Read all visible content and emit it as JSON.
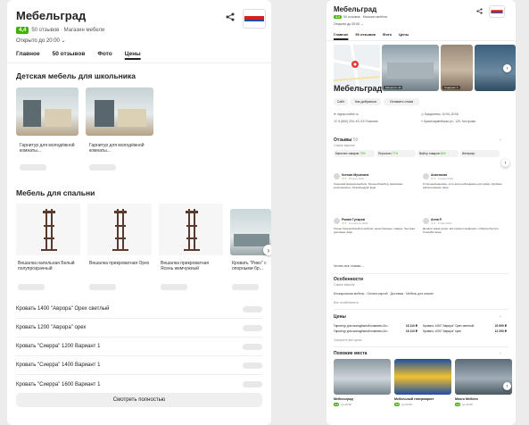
{
  "left": {
    "title": "Мебельград",
    "rating": "4,4",
    "meta": "50 отзывов · Магазин мебели",
    "hours": "Открыто до 20:00",
    "tabs": [
      "Главное",
      "50 отзывов",
      "Фото",
      "Цены"
    ],
    "section_kids": "Детская мебель для школьника",
    "kids_items": [
      "Гарнитур для молодёжной комнаты...",
      "Гарнитур для молодёжной комнаты..."
    ],
    "section_bedroom": "Мебель для спальни",
    "bedroom_items": [
      "Вешалка напольная Белый полупрозрачный",
      "Вешалка прикроватная Орех",
      "Вешалка прикроватная Ясень жемчужный",
      "Кровать \"Рико\" с опорными бр..."
    ],
    "rows": [
      "Кровать 1400 \"Аврора\" Орех светлый",
      "Кровать 1200 \"Аврора\" орех",
      "Кровать \"Сиерра\" 1200 Вариант 1",
      "Кровать \"Сиерра\" 1400 Вариант 1",
      "Кровать \"Сиерра\" 1600 Вариант 1"
    ],
    "view_all": "Смотреть полностью"
  },
  "right": {
    "top_title": "Мебельград",
    "top_rating": "4,4",
    "top_meta": "50 отзывов · Магазин мебели",
    "top_hours": "Открыто до 20:00",
    "tabs": [
      "Главное",
      "50 отзывов",
      "Фото",
      "Цены"
    ],
    "title": "Мебельград",
    "photo_labels": [
      "Как фото: 11",
      "Снаружи: 1"
    ],
    "buttons": [
      "Сайт",
      "Как добраться",
      "Оставить отзыв"
    ],
    "info_left_1": "mgrad-mebel.ru",
    "info_left_2": "8 (800) 2XX-XX-XX Показать",
    "info_right_1": "Ежедневно, 10:00–20:00",
    "info_right_2": "Красноармейская ул., 125, Кострома",
    "reviews_title": "Отзывы",
    "reviews_count": "50",
    "reviews_sub": "Самое важное",
    "review_tags": [
      "Качество товаров",
      "Персонал",
      "Выбор товаров",
      "Интерьер"
    ],
    "tag_pcts": [
      "73%",
      "77%",
      "66%",
      "..."
    ],
    "reviewers": [
      "Ксения Мусихина",
      "Анастасия",
      "Роман Гусаров",
      "Анна Р."
    ],
    "review_dates": [
      "15 мая 2024",
      "3 июня 2024",
      "12 апреля 2024",
      "5 мая 2024"
    ],
    "review_stars": [
      "5",
      "5",
      "5",
      "5"
    ],
    "review_texts": [
      "Хороший магазин мебели, большой выбор, вежливые консультанты. Рекомендую! Ещё",
      "Отличный магазин, есть всё необходимое для дома. Удобное расположение. Ещё",
      "Очень большой выбор мебели, качественные товары, быстрая доставка. Ещё",
      "Делали заказ кухни, всё пришло вовремя, собрали быстро. Спасибо! Ещё"
    ],
    "read_all": "Читать все отзывы",
    "features_title": "Особенности",
    "features_sub": "Самое важное",
    "features": "Бескаркасная мебель · Оплата картой · Доставка · Мебель для спален",
    "features_more": "Все особенности",
    "prices_title": "Цены",
    "prices": [
      {
        "name": "Гарнитур для молодёжной комнаты Ал...",
        "price": "16 110 ₽"
      },
      {
        "name": "Гарнитур для молодёжной комнаты Ал...",
        "price": "16 110 ₽"
      }
    ],
    "prices_right": [
      {
        "name": "Кровать 1400 \"Аврора\" Орех светлый",
        "price": "22 690 ₽"
      },
      {
        "name": "Кровать 1200 \"Аврора\" орех",
        "price": "12 290 ₽"
      }
    ],
    "prices_more": "Смотреть все цены",
    "similar_title": "Похожие места",
    "similar": [
      {
        "name": "Мебельград",
        "rating": "4,4",
        "meta": "до 20:00"
      },
      {
        "name": "Мебельный гипермаркет",
        "rating": "4,5",
        "meta": "до 20:00"
      },
      {
        "name": "Много Мебели",
        "rating": "4,4",
        "meta": "до 20:00"
      }
    ]
  }
}
